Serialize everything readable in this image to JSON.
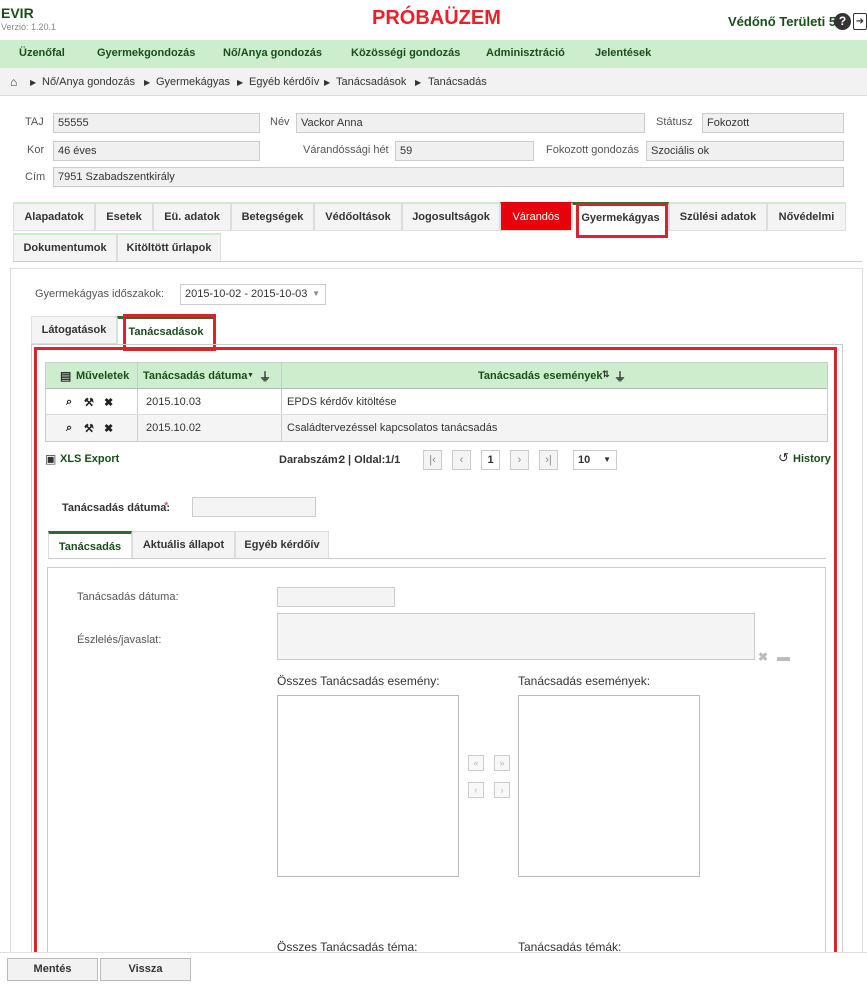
{
  "app": {
    "name": "EVIR",
    "version": "Verzió: 1.20.1",
    "mode": "PRÓBAÜZEM",
    "user": "Védőnő Területi 5"
  },
  "nav": [
    "Üzenőfal",
    "Gyermekgondozás",
    "Nő/Anya gondozás",
    "Közösségi gondozás",
    "Adminisztráció",
    "Jelentések"
  ],
  "breadcrumb": [
    "Nő/Anya gondozás",
    "Gyermekágyas",
    "Egyéb kérdőív",
    "Tanácsadások",
    "Tanácsadás"
  ],
  "patient": {
    "taj_label": "TAJ",
    "taj": "55555",
    "nev_label": "Név",
    "nev": "Vackor Anna",
    "status_label": "Státusz",
    "status": "Fokozott",
    "kor_label": "Kor",
    "kor": "46 éves",
    "het_label": "Várandóssági hét",
    "het": "59",
    "fokozott_label": "Fokozott gondozás",
    "fokozott": "Szociális ok",
    "cim_label": "Cím",
    "cim": "7951 Szabadszentkirály"
  },
  "tabs": [
    "Alapadatok",
    "Esetek",
    "Eü. adatok",
    "Betegségek",
    "Védőoltások",
    "Jogosultságok",
    "Várandós",
    "Gyermekágyas",
    "Szülési adatok",
    "Nővédelmi",
    "Dokumentumok",
    "Kitöltött űrlapok"
  ],
  "period": {
    "label": "Gyermekágyas időszakok:",
    "value": "2015-10-02 - 2015-10-03"
  },
  "subtabs": [
    "Látogatások",
    "Tanácsadások"
  ],
  "grid": {
    "headers": [
      "Műveletek",
      "Tanácsadás dátuma",
      "Tanácsadás események"
    ],
    "rows": [
      {
        "date": "2015.10.03",
        "event": "EPDS kérdőv kitöltése"
      },
      {
        "date": "2015.10.02",
        "event": "Családtervezéssel kapcsolatos tanácsadás"
      }
    ]
  },
  "export": "XLS Export",
  "pager": {
    "count_label": "Darabszám:",
    "count": "2",
    "page_label": "| Oldal:",
    "page": "1/1",
    "current": "1",
    "size": "10",
    "history": "History"
  },
  "form": {
    "date_label": "Tanácsadás dátuma:",
    "required": "*",
    "inner_tabs": [
      "Tanácsadás",
      "Aktuális állapot",
      "Egyéb kérdőív"
    ],
    "inner_date_label": "Tanácsadás dátuma:",
    "eszleles_label": "Észlelés/javaslat:",
    "all_events_label": "Összes Tanácsadás esemény:",
    "events_label": "Tanácsadás események:",
    "all_topics_label": "Összes Tanácsadás téma:",
    "topics_label": "Tanácsadás témák:"
  },
  "buttons": {
    "save": "Mentés",
    "back": "Vissza"
  },
  "colors": {
    "accent": "#1a4d1a",
    "nav_bg": "#cdeecd",
    "highlight": "#d9232d",
    "alert": "#e8000a"
  }
}
